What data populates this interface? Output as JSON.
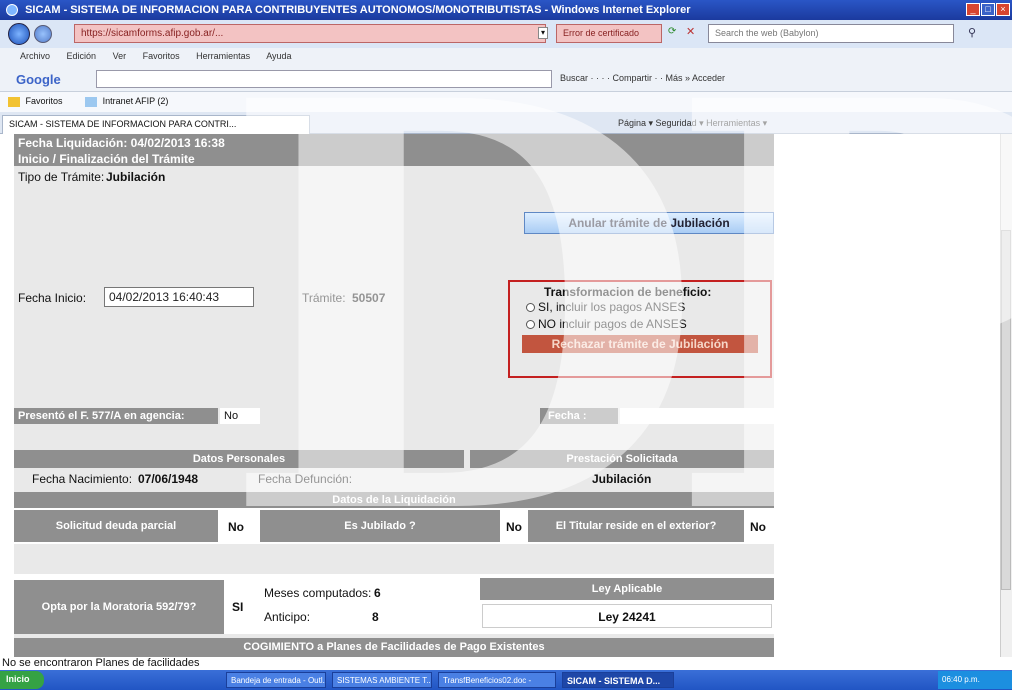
{
  "window": {
    "title": "SICAM - SISTEMA DE INFORMACION PARA CONTRIBUYENTES AUTONOMOS/MONOTRIBUTISTAS - Windows Internet Explorer"
  },
  "address": {
    "url": "https://sicamforms.afip.gob.ar/...",
    "cert_error": "Error de certificado",
    "search_placeholder": "Search the web (Babylon)"
  },
  "menu": {
    "items": [
      "Archivo",
      "Edición",
      "Ver",
      "Favoritos",
      "Herramientas",
      "Ayuda"
    ]
  },
  "google_bar": {
    "logo": "Google",
    "tools": "Buscar ·  ·  ·  · Compartir ·  · Más »   Acceder"
  },
  "favorites": {
    "label": "Favoritos",
    "item": "Intranet AFIP (2)"
  },
  "tab": {
    "label": "SICAM - SISTEMA DE INFORMACION PARA CONTRI...",
    "commands": "Página ▾  Seguridad ▾  Herramientas ▾"
  },
  "form": {
    "fecha_liquidacion": "Fecha Liquidación: 04/02/2013 16:38",
    "inicio_finalizacion": "Inicio / Finalización del Trámite",
    "tipo_tramite_label": "Tipo de Trámite:",
    "tipo_tramite_value": "Jubilación",
    "annul_button": "Anular trámite de Jubilación",
    "fecha_inicio_label": "Fecha Inicio:",
    "fecha_inicio_value": "04/02/2013 16:40:43",
    "tramite_label": "Trámite:",
    "tramite_value": "50507",
    "benefit_title": "Transformacion de beneficio:",
    "option_si": "SI, incluir los pagos ANSES",
    "option_no": "NO incluir pagos de ANSES",
    "reject_button": "Rechazar trámite de Jubilación",
    "presento_label": "Presentó el F. 577/A en agencia:",
    "presento_value": "No",
    "fecha_label": "Fecha :",
    "datos_personales": "Datos Personales",
    "prestacion_solicitada": "Prestación Solicitada",
    "fecha_nacimiento_label": "Fecha Nacimiento:",
    "fecha_nacimiento_value": "07/06/1948",
    "fecha_defuncion_label": "Fecha Defunción:",
    "prestacion_value": "Jubilación",
    "datos_liquidacion": "Datos de la Liquidación",
    "solicitud_deuda_label": "Solicitud deuda parcial",
    "solicitud_deuda_value": "No",
    "es_jubilado_label": "Es Jubilado ?",
    "es_jubilado_value": "No",
    "titular_exterior_label": "El Titular reside en el exterior?",
    "titular_exterior_value": "No",
    "moratoria_label": "Opta por la Moratoria 592/79?",
    "moratoria_value": "SI",
    "meses_label": "Meses computados:",
    "meses_value": "6",
    "anticipo_label": "Anticipo:",
    "anticipo_value": "8",
    "ley_aplicable_label": "Ley Aplicable",
    "ley_aplicable_value": "Ley 24241",
    "facilidades_header": "COGIMIENTO a Planes de Facilidades de Pago Existentes"
  },
  "status": {
    "text": "No se encontraron Planes de facilidades"
  },
  "taskbar": {
    "start": "Inicio",
    "items": [
      "Bandeja de entrada - Outl...",
      "SISTEMAS AMBIENTE T...",
      "TransfBeneficios02.doc -",
      "SICAM - SISTEMA D..."
    ],
    "clock": "06:40 p.m."
  },
  "watermark": {
    "text": "DP"
  },
  "colors": {
    "title_bar": "#1b3a9e",
    "panel_gray": "#8f8f8f",
    "reject_red": "#c2553f",
    "highlight_border": "#c42020"
  }
}
